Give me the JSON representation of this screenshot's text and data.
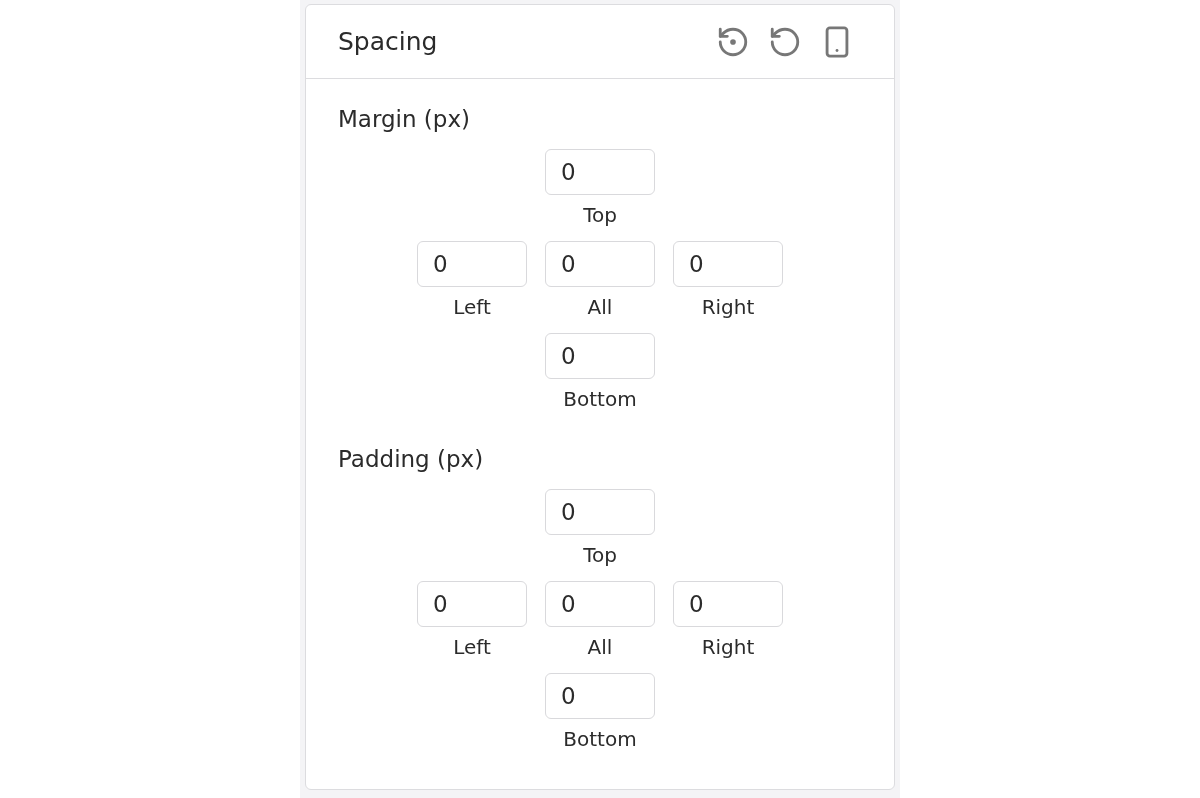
{
  "panel": {
    "title": "Spacing"
  },
  "sections": [
    {
      "title": "Margin (px)",
      "fields": [
        {
          "kind": "top",
          "value": "0",
          "label": "Top"
        },
        {
          "kind": "left",
          "value": "0",
          "label": "Left"
        },
        {
          "kind": "all",
          "value": "0",
          "label": "All"
        },
        {
          "kind": "right",
          "value": "0",
          "label": "Right"
        },
        {
          "kind": "bottom",
          "value": "0",
          "label": "Bottom"
        }
      ]
    },
    {
      "title": "Padding (px)",
      "fields": [
        {
          "kind": "top",
          "value": "0",
          "label": "Top"
        },
        {
          "kind": "left",
          "value": "0",
          "label": "Left"
        },
        {
          "kind": "all",
          "value": "0",
          "label": "All"
        },
        {
          "kind": "right",
          "value": "0",
          "label": "Right"
        },
        {
          "kind": "bottom",
          "value": "0",
          "label": "Bottom"
        }
      ]
    }
  ]
}
